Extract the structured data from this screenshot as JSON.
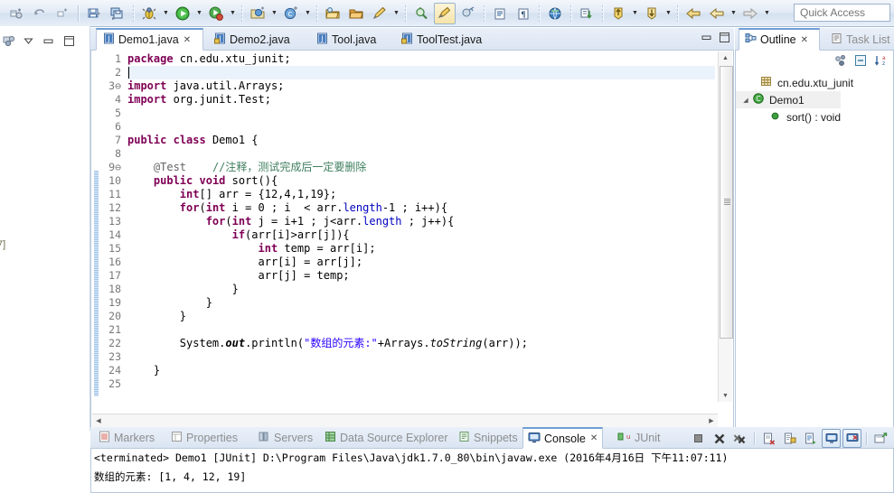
{
  "toolbar": {
    "quick_access_placeholder": "Quick Access",
    "groups": [
      {
        "name": "nav-history",
        "items": [
          {
            "icon": "new-element-icon",
            "label": "New",
            "arrow": false
          },
          {
            "icon": "undo-icon",
            "label": "Undo",
            "arrow": false
          },
          {
            "icon": "redo-icon",
            "label": "Redo",
            "arrow": false
          }
        ]
      },
      {
        "name": "save-group",
        "items": [
          {
            "icon": "save-icon",
            "label": "Save",
            "arrow": false
          },
          {
            "icon": "save-all-icon",
            "label": "Save All",
            "arrow": false
          }
        ]
      },
      {
        "name": "debug-run-group",
        "items": [
          {
            "icon": "debug-icon",
            "label": "Debug",
            "arrow": true
          },
          {
            "icon": "run-icon",
            "label": "Run",
            "arrow": true
          },
          {
            "icon": "coverage-icon",
            "label": "Coverage",
            "arrow": true
          }
        ]
      },
      {
        "name": "new-wizard-group",
        "items": [
          {
            "icon": "new-java-project-icon",
            "label": "New Java Project",
            "arrow": true
          },
          {
            "icon": "new-class-icon",
            "label": "New Class",
            "arrow": true
          }
        ]
      },
      {
        "name": "open-group",
        "items": [
          {
            "icon": "open-type-icon",
            "label": "Open Type",
            "arrow": false
          },
          {
            "icon": "open-task-icon",
            "label": "Open Task",
            "arrow": false
          },
          {
            "icon": "pencil-icon",
            "label": "Edit",
            "arrow": true
          }
        ]
      },
      {
        "name": "search-group",
        "items": [
          {
            "icon": "search-icon",
            "label": "Search",
            "arrow": false
          },
          {
            "icon": "highlight-icon",
            "label": "Toggle Mark Occurrences",
            "arrow": false,
            "pressed": true
          },
          {
            "icon": "link-icon",
            "label": "Link",
            "arrow": false
          }
        ]
      },
      {
        "name": "view-group",
        "items": [
          {
            "icon": "show-whitespace-icon",
            "label": "Show Whitespace",
            "arrow": false
          },
          {
            "icon": "pilcrow-icon",
            "label": "Show Print Margin",
            "arrow": false
          }
        ]
      },
      {
        "name": "web-group",
        "items": [
          {
            "icon": "globe-icon",
            "label": "Open Web Browser",
            "arrow": false
          }
        ]
      },
      {
        "name": "annotation-group",
        "items": [
          {
            "icon": "next-annotation-icon",
            "label": "Next Annotation",
            "arrow": false
          }
        ]
      },
      {
        "name": "marker-group",
        "items": [
          {
            "icon": "prev-marker-icon",
            "label": "Previous Marker",
            "arrow": true
          },
          {
            "icon": "next-marker-icon",
            "label": "Next Marker",
            "arrow": true
          }
        ]
      },
      {
        "name": "back-forward-group",
        "items": [
          {
            "icon": "back-icon",
            "label": "Back",
            "arrow": false
          },
          {
            "icon": "back-history-icon",
            "label": "Back History",
            "arrow": true
          },
          {
            "icon": "forward-icon",
            "label": "Forward",
            "arrow": true
          }
        ]
      }
    ]
  },
  "editor": {
    "tabs": [
      {
        "label": "Demo1.java",
        "active": true,
        "closable": true,
        "icon": "java-file-icon"
      },
      {
        "label": "Demo2.java",
        "active": false,
        "closable": false,
        "icon": "java-file-locked-icon"
      },
      {
        "label": "Tool.java",
        "active": false,
        "closable": false,
        "icon": "java-file-icon"
      },
      {
        "label": "ToolTest.java",
        "active": false,
        "closable": false,
        "icon": "java-file-locked-icon"
      }
    ],
    "minimize_label": "Minimize",
    "maximize_label": "Maximize",
    "first_line": 1,
    "line_numbers": [
      1,
      2,
      3,
      4,
      5,
      6,
      7,
      8,
      9,
      10,
      11,
      12,
      13,
      14,
      15,
      16,
      17,
      18,
      19,
      20,
      21,
      22,
      23,
      24,
      25
    ],
    "folding_lines": [
      3,
      9
    ],
    "caret_line": 2,
    "code_lines": [
      "package cn.edu.xtu_junit;",
      "",
      "import java.util.Arrays;",
      "import org.junit.Test;",
      "",
      "",
      "public class Demo1 {",
      "",
      "    @Test    //注释，测试完成后一定要删除",
      "    public void sort(){",
      "        int[] arr = {12,4,1,19};",
      "        for(int i = 0 ; i  < arr.length-1 ; i++){",
      "            for(int j = i+1 ; j<arr.length ; j++){",
      "                if(arr[i]>arr[j]){",
      "                    int temp = arr[i];",
      "                    arr[i] = arr[j];",
      "                    arr[j] = temp;",
      "                }",
      "            }",
      "        }",
      "",
      "        System.out.println(\"数组的元素:\"+Arrays.toString(arr));",
      "",
      "    }",
      ""
    ]
  },
  "outline": {
    "tabs": [
      {
        "label": "Outline",
        "active": true,
        "closable": true,
        "icon": "outline-icon"
      },
      {
        "label": "Task List",
        "active": false,
        "closable": false,
        "icon": "task-list-icon"
      }
    ],
    "tools": [
      {
        "icon": "sort-members-icon",
        "label": "Hide Fields"
      },
      {
        "icon": "collapse-all-icon",
        "label": "Collapse All"
      },
      {
        "icon": "sort-alphabetically-icon",
        "label": "Sort"
      }
    ],
    "tree": [
      {
        "icon": "package-icon",
        "label": "cn.edu.xtu_junit",
        "indent": 0,
        "twisty": ""
      },
      {
        "icon": "class-icon",
        "label": "Demo1",
        "indent": 0,
        "twisty": "expanded",
        "selected": true
      },
      {
        "icon": "method-icon",
        "label": "sort() : void",
        "indent": 1,
        "twisty": ""
      }
    ]
  },
  "bottom": {
    "tabs": [
      {
        "label": "Markers",
        "active": false,
        "icon": "markers-icon"
      },
      {
        "label": "Properties",
        "active": false,
        "icon": "properties-icon"
      },
      {
        "label": "Servers",
        "active": false,
        "icon": "servers-icon"
      },
      {
        "label": "Data Source Explorer",
        "active": false,
        "icon": "datasource-icon"
      },
      {
        "label": "Snippets",
        "active": false,
        "icon": "snippets-icon"
      },
      {
        "label": "Console",
        "active": true,
        "icon": "console-icon",
        "closable": true
      },
      {
        "label": "JUnit",
        "active": false,
        "icon": "junit-icon"
      }
    ],
    "tools": [
      {
        "icon": "terminate-icon",
        "label": "Terminate",
        "boxed": false
      },
      {
        "icon": "remove-launch-icon",
        "label": "Remove Launch",
        "boxed": false
      },
      {
        "icon": "remove-all-terminated-icon",
        "label": "Remove All Terminated Launches",
        "boxed": false
      },
      {
        "icon": "clear-console-icon",
        "label": "Clear Console",
        "boxed": false
      },
      {
        "icon": "scroll-lock-icon",
        "label": "Scroll Lock",
        "boxed": false
      },
      {
        "icon": "word-wrap-icon",
        "label": "Word Wrap",
        "boxed": false
      },
      {
        "icon": "show-console-icon",
        "label": "Show Console When Output Changes",
        "boxed": true
      },
      {
        "icon": "pin-console-icon",
        "label": "Pin Console",
        "boxed": true
      },
      {
        "icon": "open-console-icon",
        "label": "Open Console",
        "boxed": false
      }
    ],
    "console_header": "<terminated> Demo1 [JUnit] D:\\Program Files\\Java\\jdk1.7.0_80\\bin\\javaw.exe (2016年4月16日 下午11:07:11)",
    "console_output": "数组的元素: [1, 4, 12, 19]"
  },
  "leftstrip": {
    "restore_label": "Restore",
    "fast_view_label": "Package Explorer",
    "ghost_text": "7]"
  }
}
